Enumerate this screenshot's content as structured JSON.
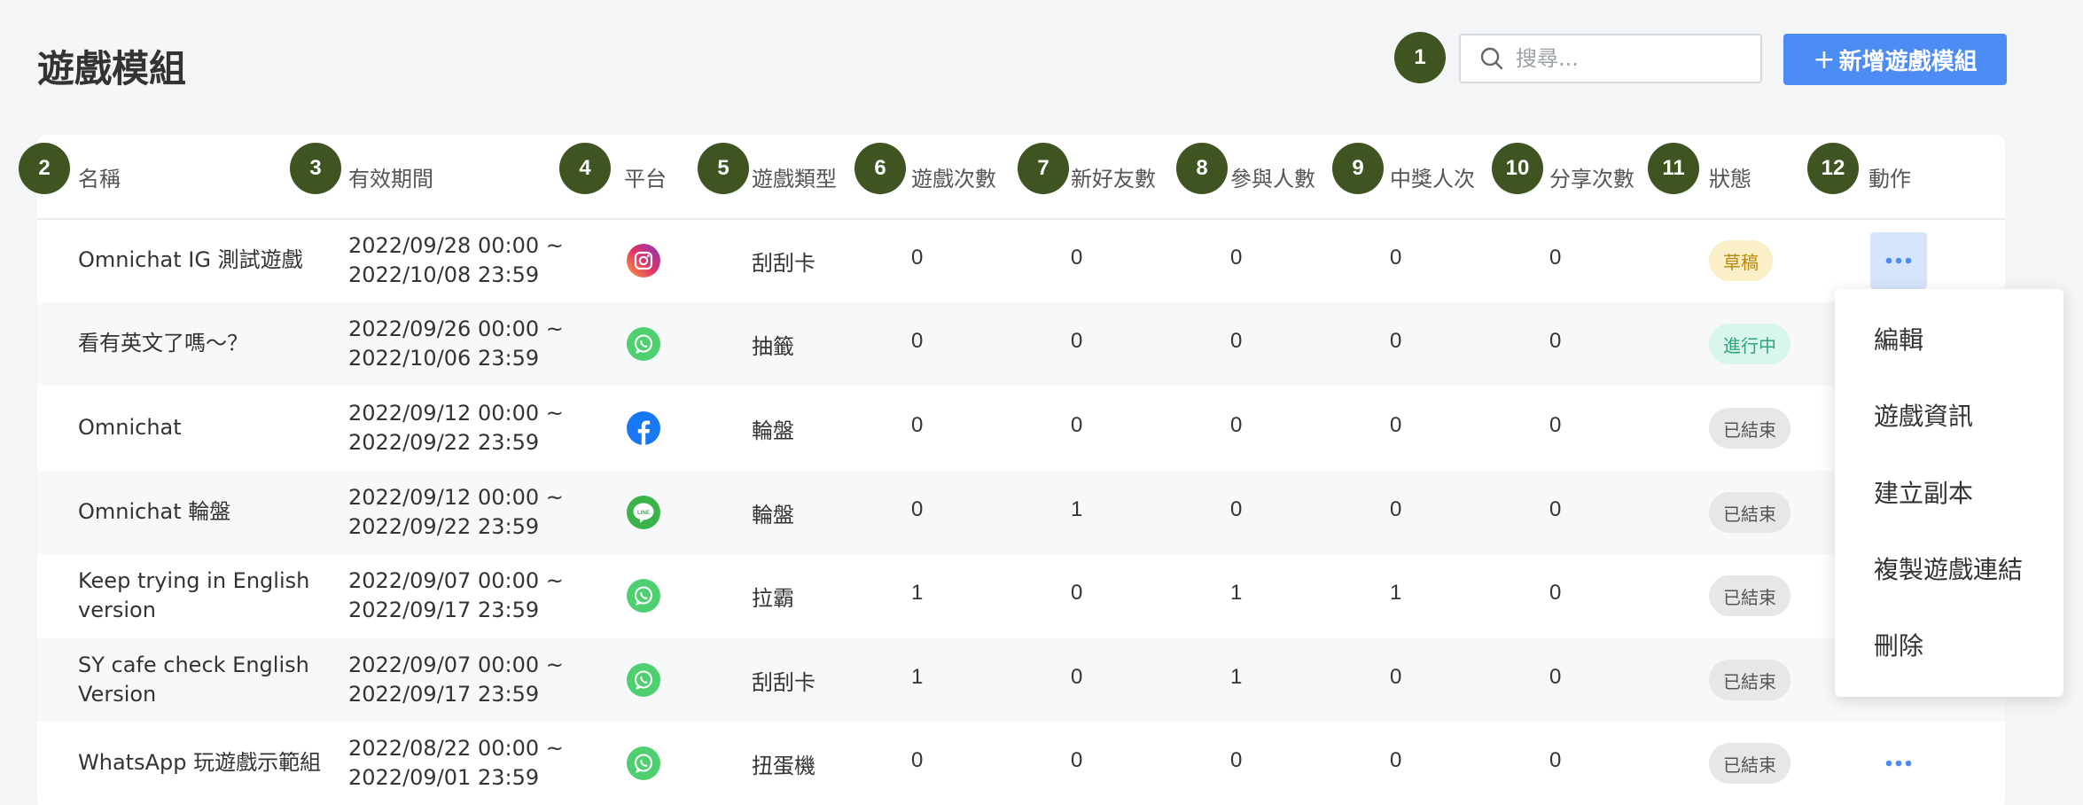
{
  "page": {
    "title": "遊戲模組"
  },
  "toolbar": {
    "search_placeholder": "搜尋...",
    "add_label": "新增遊戲模組",
    "add_icon": "plus-icon"
  },
  "markers": [
    "1",
    "2",
    "3",
    "4",
    "5",
    "6",
    "7",
    "8",
    "9",
    "10",
    "11",
    "12"
  ],
  "columns": [
    "名稱",
    "有效期間",
    "平台",
    "遊戲類型",
    "遊戲次數",
    "新好友數",
    "參與人數",
    "中獎人次",
    "分享次數",
    "狀態",
    "動作"
  ],
  "rows": [
    {
      "name": "Omnichat IG 測試遊戲",
      "period_start": "2022/09/28 00:00 ~",
      "period_end": "2022/10/08 23:59",
      "platform": "instagram",
      "type": "刮刮卡",
      "plays": "0",
      "new_friends": "0",
      "participants": "0",
      "winners": "0",
      "shares": "0",
      "status": "草稿",
      "status_kind": "draft"
    },
    {
      "name": "看有英文了嗎～？",
      "period_start": "2022/09/26 00:00 ~",
      "period_end": "2022/10/06 23:59",
      "platform": "whatsapp",
      "type": "抽籤",
      "plays": "0",
      "new_friends": "0",
      "participants": "0",
      "winners": "0",
      "shares": "0",
      "status": "進行中",
      "status_kind": "active"
    },
    {
      "name": "Omnichat",
      "period_start": "2022/09/12 00:00 ~",
      "period_end": "2022/09/22 23:59",
      "platform": "facebook",
      "type": "輪盤",
      "plays": "0",
      "new_friends": "0",
      "participants": "0",
      "winners": "0",
      "shares": "0",
      "status": "已結束",
      "status_kind": "ended"
    },
    {
      "name": "Omnichat 輪盤",
      "period_start": "2022/09/12 00:00 ~",
      "period_end": "2022/09/22 23:59",
      "platform": "line",
      "type": "輪盤",
      "plays": "0",
      "new_friends": "1",
      "participants": "0",
      "winners": "0",
      "shares": "0",
      "status": "已結束",
      "status_kind": "ended"
    },
    {
      "name_line1": "Keep trying in English",
      "name_line2": "version",
      "period_start": "2022/09/07 00:00 ~",
      "period_end": "2022/09/17 23:59",
      "platform": "whatsapp",
      "type": "拉霸",
      "plays": "1",
      "new_friends": "0",
      "participants": "1",
      "winners": "1",
      "shares": "0",
      "status": "已結束",
      "status_kind": "ended"
    },
    {
      "name_line1": "SY cafe check English",
      "name_line2": "Version",
      "period_start": "2022/09/07 00:00 ~",
      "period_end": "2022/09/17 23:59",
      "platform": "whatsapp",
      "type": "刮刮卡",
      "plays": "1",
      "new_friends": "0",
      "participants": "1",
      "winners": "0",
      "shares": "0",
      "status": "已結束",
      "status_kind": "ended"
    },
    {
      "name": "WhatsApp 玩遊戲示範組",
      "period_start": "2022/08/22 00:00 ~",
      "period_end": "2022/09/01 23:59",
      "platform": "whatsapp",
      "type": "扭蛋機",
      "plays": "0",
      "new_friends": "0",
      "participants": "0",
      "winners": "0",
      "shares": "0",
      "status": "已結束",
      "status_kind": "ended"
    }
  ],
  "menu": [
    "編輯",
    "遊戲資訊",
    "建立副本",
    "複製遊戲連結",
    "刪除"
  ],
  "colors": {
    "marker": "#3f5420",
    "primary": "#4d8bf5",
    "draft_bg": "#fbefc7",
    "draft_fg": "#b8860b",
    "active_bg": "#d8f6ea",
    "active_fg": "#2fa47a",
    "ended_bg": "#e6e7e9",
    "ended_fg": "#555555",
    "instagram": "#d6249f",
    "whatsapp": "#4fcf70",
    "facebook": "#1877f2",
    "line": "#3bb34a"
  }
}
